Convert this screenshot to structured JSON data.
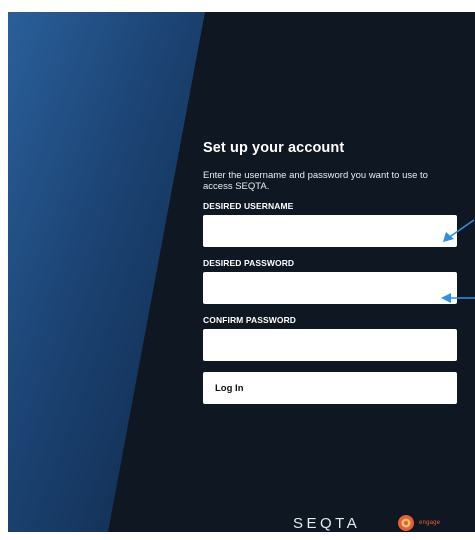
{
  "form": {
    "title": "Set up your account",
    "subtitle": "Enter the username and password you want to use to access SEQTA.",
    "username_label": "DESIRED USERNAME",
    "username_value": "",
    "password_label": "DESIRED PASSWORD",
    "password_value": "",
    "confirm_label": "CONFIRM PASSWORD",
    "confirm_value": "",
    "submit_label": "Log In"
  },
  "footer": {
    "brand": "SEQTA",
    "engage_label": "engage"
  },
  "colors": {
    "background_dark": "#0f1722",
    "panel_blue": "#1f4f86",
    "annotation_arrow": "#2f8fe0",
    "engage_orange": "#e0613a"
  },
  "icons": {
    "engage_logo": "engage-logo-icon",
    "arrow_1": "pointer-arrow-icon",
    "arrow_2": "pointer-arrow-icon"
  }
}
